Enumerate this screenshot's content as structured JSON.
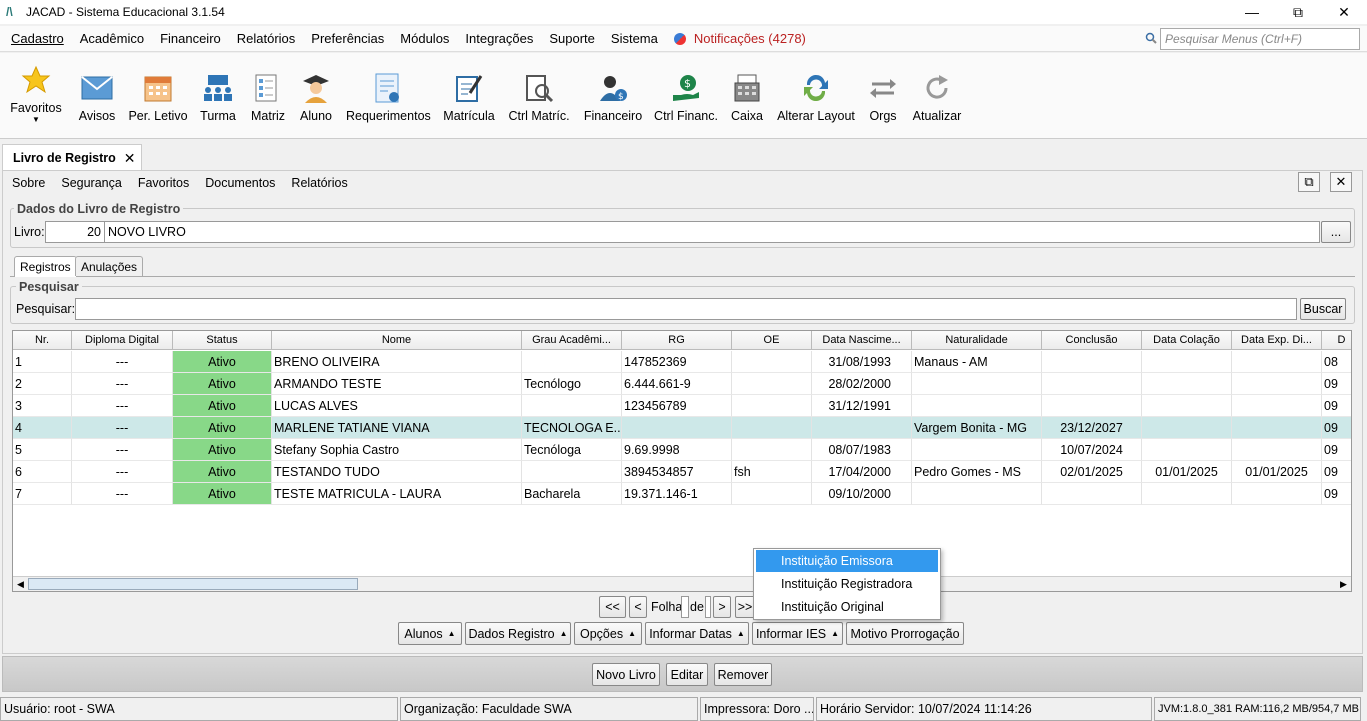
{
  "window": {
    "title": "JACAD - Sistema Educacional 3.1.54",
    "minimize": "—",
    "restore": "⧉",
    "close": "✕"
  },
  "menu": {
    "items": [
      "Cadastro",
      "Acadêmico",
      "Financeiro",
      "Relatórios",
      "Preferências",
      "Módulos",
      "Integrações",
      "Suporte",
      "Sistema"
    ],
    "notifications": "Notificações (4278)",
    "search_placeholder": "Pesquisar Menus (Ctrl+F)"
  },
  "toolbar": {
    "favoritos": "Favoritos",
    "avisos": "Avisos",
    "per_letivo": "Per. Letivo",
    "turma": "Turma",
    "matriz": "Matriz",
    "aluno": "Aluno",
    "requerimentos": "Requerimentos",
    "matricula": "Matrícula",
    "ctrl_matric": "Ctrl Matríc.",
    "financeiro": "Financeiro",
    "ctrl_financ": "Ctrl Financ.",
    "caixa": "Caixa",
    "alterar_layout": "Alterar Layout",
    "orgs": "Orgs",
    "atualizar": "Atualizar"
  },
  "tab": {
    "title": "Livro de Registro",
    "close": "✕"
  },
  "submenu": [
    "Sobre",
    "Segurança",
    "Favoritos",
    "Documentos",
    "Relatórios"
  ],
  "dados": {
    "group_title": "Dados do Livro de Registro",
    "livro_label": "Livro:",
    "livro_num": "20",
    "livro_nome": "NOVO LIVRO",
    "browse": "..."
  },
  "subtabs": [
    "Registros",
    "Anulações"
  ],
  "pesquisa": {
    "group_title": "Pesquisar",
    "label": "Pesquisar:",
    "value": "",
    "button": "Buscar"
  },
  "table": {
    "columns": [
      "Nr.",
      "Diploma Digital",
      "Status",
      "Nome",
      "Grau Acadêmi...",
      "RG",
      "OE",
      "Data Nascime...",
      "Naturalidade",
      "Conclusão",
      "Data Colação",
      "Data Exp. Di...",
      "D"
    ],
    "rows": [
      [
        "1",
        "---",
        "Ativo",
        "BRENO OLIVEIRA",
        "",
        "147852369",
        "",
        "31/08/1993",
        "Manaus - AM",
        "",
        "",
        "",
        "08"
      ],
      [
        "2",
        "---",
        "Ativo",
        "ARMANDO TESTE",
        "Tecnólogo",
        "6.444.661-9",
        "",
        "28/02/2000",
        "",
        "",
        "",
        "",
        "09"
      ],
      [
        "3",
        "---",
        "Ativo",
        "LUCAS ALVES",
        "",
        "123456789",
        "",
        "31/12/1991",
        "",
        "",
        "",
        "",
        "09"
      ],
      [
        "4",
        "---",
        "Ativo",
        "MARLENE TATIANE VIANA",
        "TECNOLOGA E...",
        "",
        "",
        "",
        "Vargem Bonita - MG",
        "23/12/2027",
        "",
        "",
        "09"
      ],
      [
        "5",
        "---",
        "Ativo",
        "Stefany Sophia Castro",
        "Tecnóloga",
        "9.69.9998",
        "",
        "08/07/1983",
        "",
        "10/07/2024",
        "",
        "",
        "09"
      ],
      [
        "6",
        "---",
        "Ativo",
        "TESTANDO TUDO",
        "",
        "3894534857",
        "fsh",
        "17/04/2000",
        "Pedro Gomes - MS",
        "02/01/2025",
        "01/01/2025",
        "01/01/2025",
        "09"
      ],
      [
        "7",
        "---",
        "Ativo",
        "TESTE MATRICULA - LAURA",
        "Bacharela",
        "19.371.146-1",
        "",
        "09/10/2000",
        "",
        "",
        "",
        "",
        "09"
      ]
    ],
    "selected_row": 4
  },
  "pager": {
    "first": "<<",
    "prev": "<",
    "folha": "Folha",
    "page": "",
    "de": "de",
    "total": "",
    "next": ">",
    "last": ">>"
  },
  "popup": [
    "Instituição Emissora",
    "Instituição Registradora",
    "Instituição Original"
  ],
  "actions": [
    "Alunos",
    "Dados Registro",
    "Opções",
    "Informar Datas",
    "Informar IES",
    "Motivo Prorrogação"
  ],
  "bottom_buttons": [
    "Novo Livro",
    "Editar",
    "Remover"
  ],
  "status": {
    "usuario": "Usuário: root - SWA",
    "organizacao": "Organização: Faculdade SWA",
    "impressora": "Impressora: Doro ...",
    "horario": "Horário Servidor: 10/07/2024 11:14:26",
    "jvm": "JVM:1.8.0_381  RAM:116,2 MB/954,7 MB"
  },
  "colors": {
    "status_active": "#88d888",
    "selected_row": "#cde8e8",
    "popup_highlight": "#3399ee",
    "notification": "#bb2222"
  }
}
